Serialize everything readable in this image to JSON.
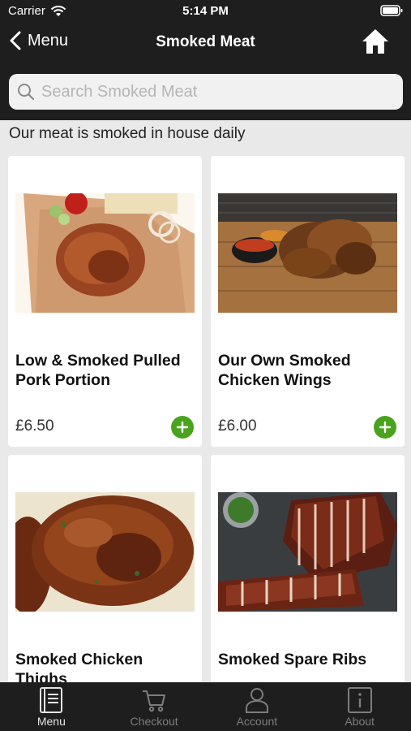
{
  "status_bar": {
    "carrier": "Carrier",
    "time": "5:14 PM"
  },
  "nav": {
    "back_label": "Menu",
    "title": "Smoked Meat"
  },
  "search": {
    "placeholder": "Search Smoked Meat"
  },
  "subtitle": "Our meat is smoked in house daily",
  "products": [
    {
      "name": "Low & Smoked Pulled Pork Portion",
      "price": "£6.50"
    },
    {
      "name": "Our Own Smoked Chicken Wings",
      "price": "£6.00"
    },
    {
      "name": "Smoked Chicken Thighs",
      "price": ""
    },
    {
      "name": "Smoked Spare Ribs",
      "price": ""
    }
  ],
  "tabs": [
    {
      "label": "Menu",
      "icon": "menu-book-icon",
      "active": true
    },
    {
      "label": "Checkout",
      "icon": "cart-icon",
      "active": false
    },
    {
      "label": "Account",
      "icon": "person-icon",
      "active": false
    },
    {
      "label": "About",
      "icon": "info-icon",
      "active": false
    }
  ],
  "colors": {
    "bar": "#1f1e1e",
    "accent_green": "#4aa31d",
    "background": "#e9e9e9"
  }
}
